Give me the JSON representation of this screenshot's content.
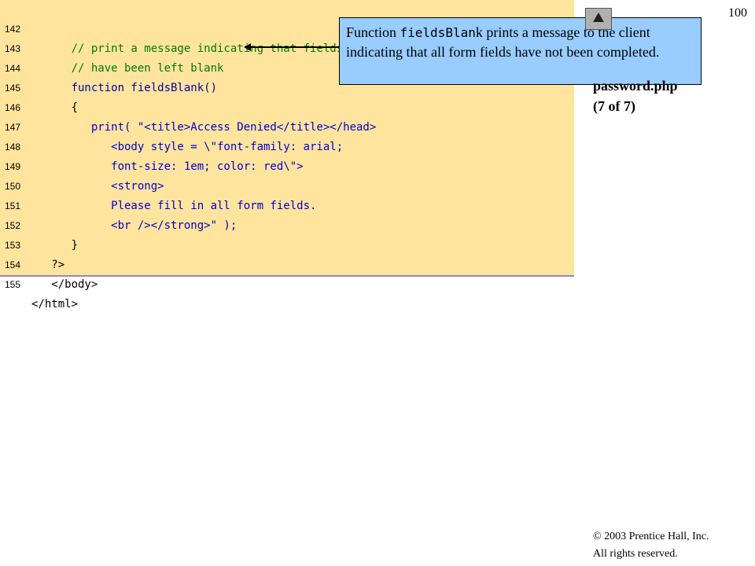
{
  "page_number": "100",
  "side_label": {
    "line1": "password.php",
    "line2": "(7 of 7)"
  },
  "callout": {
    "prefix": "Function ",
    "code": "fieldsBlan",
    "suffix_before": "k prints a message to the client indicating that all form fields have not been completed."
  },
  "copyright": {
    "line1": "© 2003 Prentice Hall, Inc.",
    "line2": "All rights reserved."
  },
  "code_lines": [
    {
      "num": "142",
      "text": "      // print a message indicating that fields"
    },
    {
      "num": "143",
      "text": "      // have been left blank"
    },
    {
      "num": "144",
      "text": "      function fieldsBlank()"
    },
    {
      "num": "145",
      "text": "      {"
    },
    {
      "num": "146",
      "text": "         print( \"<title>Access Denied</title></head>"
    },
    {
      "num": "147",
      "text": "            <body style = \\\"font-family: arial;"
    },
    {
      "num": "148",
      "text": "            font-size: 1em; color: red\\\">"
    },
    {
      "num": "149",
      "text": "            <strong>"
    },
    {
      "num": "150",
      "text": "            Please fill in all form fields."
    },
    {
      "num": "151",
      "text": "            <br /></strong>\" );"
    },
    {
      "num": "152",
      "text": "      }"
    },
    {
      "num": "153",
      "text": "   ?>"
    },
    {
      "num": "154",
      "text": "   </body>"
    },
    {
      "num": "155",
      "text": "</html>"
    }
  ],
  "colors": {
    "code_background": "#ffe49e",
    "callout_background": "#99ccff"
  }
}
